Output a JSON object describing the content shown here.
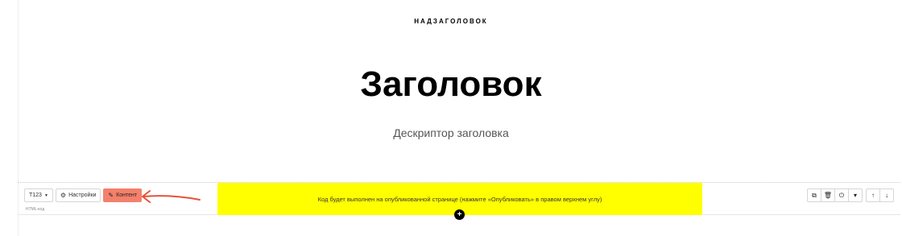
{
  "hero": {
    "overline": "НАДЗАГОЛОВОК",
    "title": "Заголовок",
    "descriptor": "Дескриптор заголовка"
  },
  "block_toolbar": {
    "block_type": "T123",
    "settings_label": "Настройки",
    "content_label": "Контент",
    "block_code_label": "HTML-код",
    "notice": "Код будет выполнен на опубликованной странице (нажмите «Опубликовать» в правом верхнем углу)",
    "add_block_symbol": "+",
    "accent_color": "#f4806b",
    "notice_color": "#ffff00"
  },
  "right_tools": {
    "icons": [
      "copy-icon",
      "delete-icon",
      "power-icon",
      "more-caret-icon",
      "move-up-icon",
      "move-down-icon"
    ]
  },
  "annotation": {
    "arrow_color": "#e8503a"
  }
}
